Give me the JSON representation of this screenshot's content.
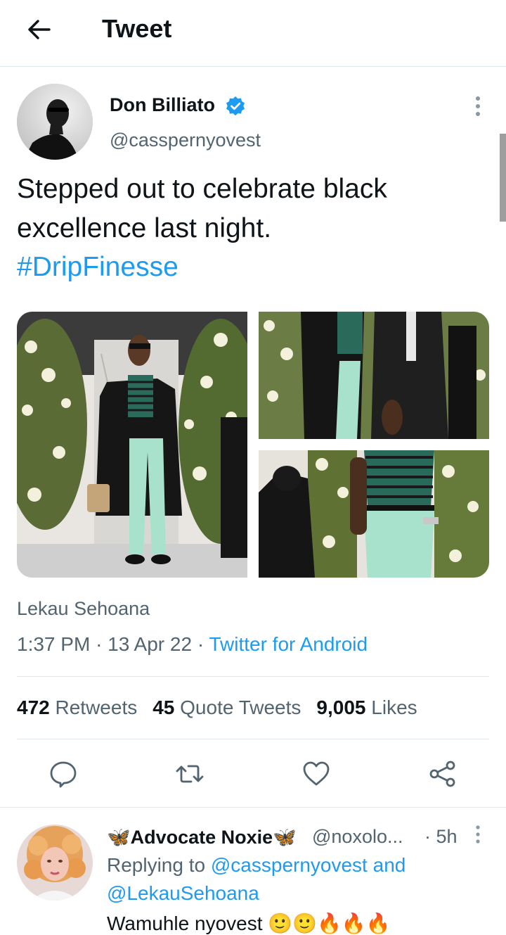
{
  "header": {
    "title": "Tweet",
    "back_icon": "arrow-left-icon"
  },
  "author": {
    "name": "Don Billiato",
    "handle": "@casspernyovest",
    "verified": true,
    "verified_color": "#1d9bf0"
  },
  "tweet": {
    "text": "Stepped out to celebrate black excellence last night.",
    "hashtag": "#DripFinesse",
    "tagged_user": "Lekau Sehoana",
    "time": "1:37 PM",
    "date": "13 Apr 22",
    "source": "Twitter for Android"
  },
  "stats": {
    "retweets": "472",
    "retweets_label": "Retweets",
    "quotes": "45",
    "quotes_label": "Quote Tweets",
    "likes": "9,005",
    "likes_label": "Likes"
  },
  "actions": [
    "reply-icon",
    "retweet-icon",
    "like-icon",
    "share-icon"
  ],
  "reply": {
    "name": "🦋Advocate Noxie🦋",
    "handle": "@noxolo...",
    "time": "· 5h",
    "replying_prefix": "Replying to",
    "replying_user1": "@casspernyovest",
    "replying_and": "and",
    "replying_user2": "@LekauSehoana",
    "text": "Wamuhle nyovest 🙂🙂🔥🔥🔥"
  },
  "colors": {
    "accent": "#1d9bf0",
    "secondary_text": "#536471",
    "divider": "#e1e8ed"
  }
}
